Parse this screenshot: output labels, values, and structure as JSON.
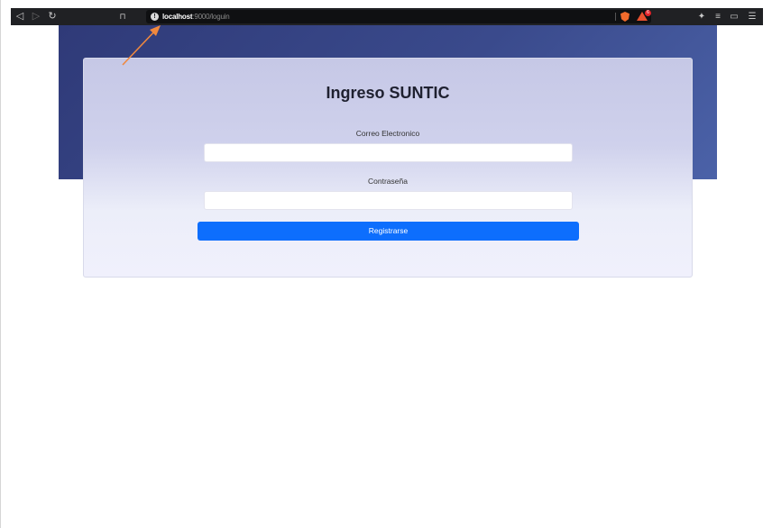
{
  "browser": {
    "url_host": "localhost",
    "url_path": ":9000/loguin",
    "rewards_count": "6",
    "icons": [
      "back-icon",
      "forward-icon",
      "reload-icon",
      "bookmark-icon",
      "site-info-icon",
      "brave-shields-icon",
      "brave-rewards-icon",
      "extensions-icon",
      "playlist-icon",
      "wallet-icon",
      "menu-icon"
    ]
  },
  "login": {
    "title": "Ingreso SUNTIC",
    "email_label": "Correo Electronico",
    "email_value": "",
    "password_label": "Contraseña",
    "password_value": "",
    "submit_label": "Registrarse"
  },
  "colors": {
    "hero_start": "#2f3a78",
    "hero_end": "#4b62a8",
    "button": "#0d6efd",
    "annotation_arrow": "#f0883e"
  }
}
